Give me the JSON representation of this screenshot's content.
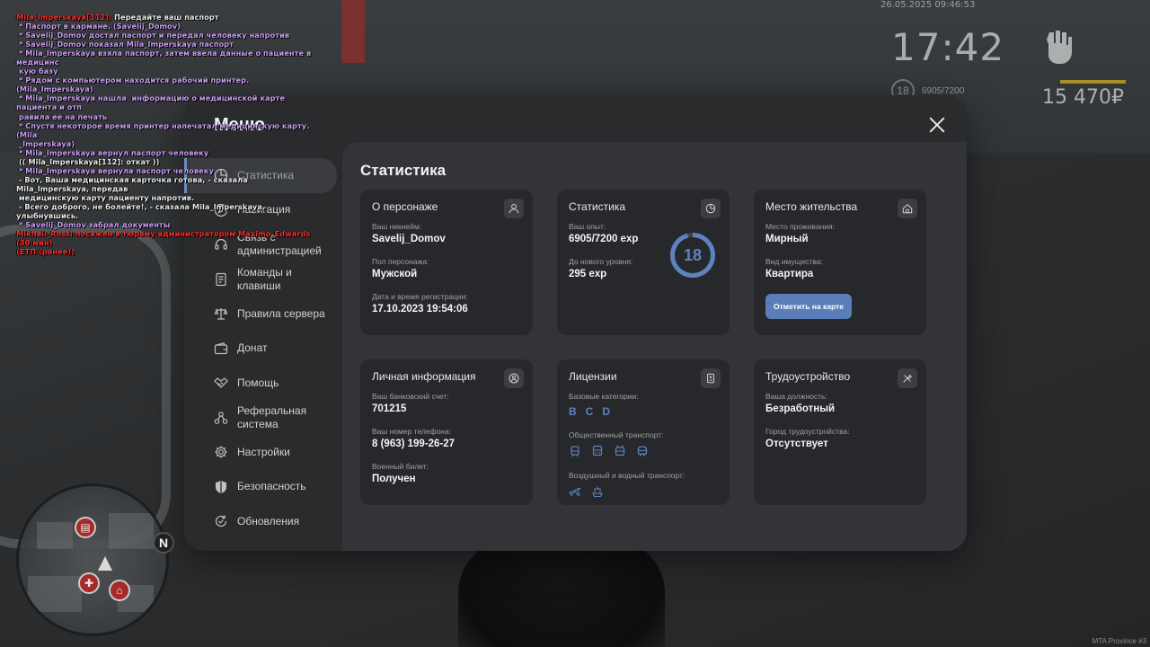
{
  "hud": {
    "datetime": "26.05.2025 09:46:53",
    "time": "17:42",
    "level": "18",
    "exp": "6905/7200",
    "money": "15 470₽",
    "watermark": "MTA Province #3"
  },
  "chat": [
    {
      "color": "mixed",
      "prefix": "Mila_Imperskaya[112]:",
      "text": " Передайте ваш паспорт"
    },
    {
      "color": "pink",
      "text": " * Паспорт в кармане. (Savelij_Domov)"
    },
    {
      "color": "pink",
      "text": " * Savelij_Domov достал паспорт и передал человеку напротив"
    },
    {
      "color": "pink",
      "text": " * Savelij_Domov показал Mila_Imperskaya паспорт"
    },
    {
      "color": "pink",
      "text": " * Mila_Imperskaya взяла паспорт, затем ввела данные о пациенте в медицинс"
    },
    {
      "color": "pink",
      "text": " кую базу"
    },
    {
      "color": "pink",
      "text": " * Рядом с компьютером находится рабочий принтер. (Mila_Imperskaya)"
    },
    {
      "color": "pink",
      "text": " * Mila_Imperskaya нашла  информацию о медицинской карте пациента и отп"
    },
    {
      "color": "pink",
      "text": " равила ее на печать"
    },
    {
      "color": "pink",
      "text": " * Спустя некоторое время принтер напечатал медицинскую карту. (Mila"
    },
    {
      "color": "pink",
      "text": " _Imperskaya)"
    },
    {
      "color": "pink",
      "text": " * Mila_Imperskaya вернул паспорт человеку"
    },
    {
      "color": "white",
      "text": " (( Mila_Imperskaya[112]: откат ))"
    },
    {
      "color": "pink",
      "text": " * Mila_Imperskaya вернула паспорт человеку"
    },
    {
      "color": "white",
      "text": " - Вот, Ваша медицинская карточка готова, - сказала Mila_Imperskaya, передав"
    },
    {
      "color": "white",
      "text": " медицинскую карту пациенту напротив."
    },
    {
      "color": "white",
      "text": " - Всего доброго, не болейте!, - сказала Mila_Imperskaya, улыбнувшись."
    },
    {
      "color": "pink",
      "text": " * Savelij_Domov забрал документы"
    },
    {
      "color": "red",
      "text": "Mikhail_Rossi посажен в тюрьму администратором Maximo_Edwards (30 мин)"
    },
    {
      "color": "red",
      "text": "(ЕТП (ранее))"
    }
  ],
  "menu": {
    "title": "Меню",
    "sidebar": [
      {
        "label": "Статистика",
        "icon": "statistics-icon",
        "active": true
      },
      {
        "label": "Навигация",
        "icon": "compass-icon"
      },
      {
        "label": "Связь с\nадминистрацией",
        "icon": "headset-icon"
      },
      {
        "label": "Команды и\nклавиши",
        "icon": "document-icon"
      },
      {
        "label": "Правила сервера",
        "icon": "scales-icon"
      },
      {
        "label": "Донат",
        "icon": "wallet-icon"
      },
      {
        "label": "Помощь",
        "icon": "handshake-icon"
      },
      {
        "label": "Реферальная\nсистема",
        "icon": "referral-icon"
      },
      {
        "label": "Настройки",
        "icon": "gear-icon"
      },
      {
        "label": "Безопасность",
        "icon": "shield-icon"
      },
      {
        "label": "Обновления",
        "icon": "refresh-icon"
      }
    ],
    "content_title": "Статистика",
    "cards": {
      "character": {
        "title": "О персонаже",
        "nickname_label": "Ваш никнейм:",
        "nickname": "Savelij_Domov",
        "gender_label": "Пол персонажа:",
        "gender": "Мужской",
        "reg_label": "Дата и время регистрации:",
        "reg": "17.10.2023 19:54:06"
      },
      "stats": {
        "title": "Статистика",
        "exp_label": "Ваш опыт:",
        "exp": "6905/7200 exp",
        "next_label": "До нового уровня:",
        "next": "295 exp",
        "level": "18",
        "progress": 0.959
      },
      "residence": {
        "title": "Место жительства",
        "place_label": "Место проживания:",
        "place": "Мирный",
        "type_label": "Вид имущества:",
        "type": "Квартира",
        "button": "Отметить на карте"
      },
      "personal": {
        "title": "Личная информация",
        "bank_label": "Ваш банковский счет:",
        "bank": "701215",
        "phone_label": "Ваш номер телефона:",
        "phone": "8 (963) 199-26-27",
        "military_label": "Военный билет:",
        "military": "Получен"
      },
      "licenses": {
        "title": "Лицензии",
        "base_label": "Базовые категории:",
        "categories": [
          "B",
          "C",
          "D"
        ],
        "public_label": "Общественный транспорт:",
        "air_label": "Воздушный и водный транспорт:"
      },
      "job": {
        "title": "Трудоустройство",
        "position_label": "Ваша должность:",
        "position": "Безработный",
        "city_label": "Город трудоустройства:",
        "city": "Отсутствует"
      }
    }
  }
}
